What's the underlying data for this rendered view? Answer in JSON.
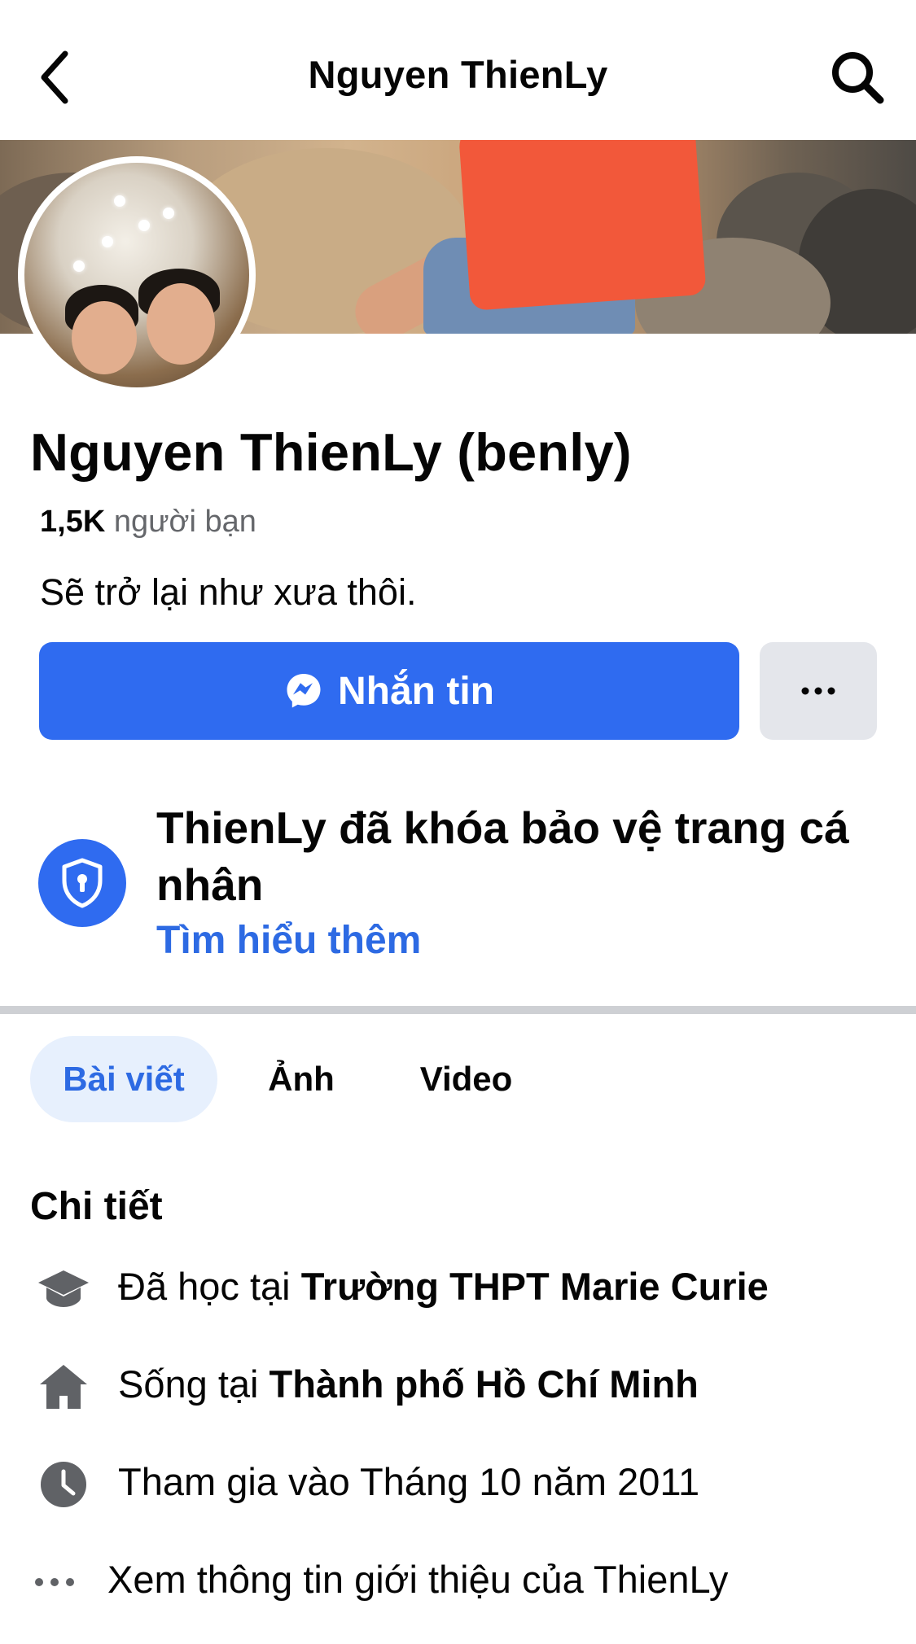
{
  "header": {
    "title": "Nguyen ThienLy",
    "back_icon": "chevron-left-icon",
    "search_icon": "search-icon"
  },
  "profile": {
    "name": "Nguyen ThienLy (benly)",
    "friends_count": "1,5K",
    "friends_label": "người bạn",
    "bio": "Sẽ trở lại như xưa thôi."
  },
  "actions": {
    "message_label": "Nhắn tin",
    "message_icon": "messenger-icon",
    "more_icon": "more-dots-icon"
  },
  "lock_notice": {
    "title": "ThienLy đã khóa bảo vệ trang cá nhân",
    "link": "Tìm hiểu thêm",
    "icon": "shield-lock-icon"
  },
  "tabs": [
    {
      "label": "Bài viết",
      "active": true
    },
    {
      "label": "Ảnh",
      "active": false
    },
    {
      "label": "Video",
      "active": false
    }
  ],
  "details": {
    "title": "Chi tiết",
    "items": [
      {
        "icon": "graduation-cap-icon",
        "prefix": "Đã học tại ",
        "value": "Trường THPT Marie Curie"
      },
      {
        "icon": "home-icon",
        "prefix": "Sống tại ",
        "value": "Thành phố Hồ Chí Minh"
      },
      {
        "icon": "clock-icon",
        "prefix": "Tham gia vào Tháng 10 năm 2011",
        "value": ""
      },
      {
        "icon": "more-dots-icon",
        "prefix": "Xem thông tin giới thiệu của ThienLy",
        "value": ""
      }
    ]
  },
  "colors": {
    "accent": "#2f6bf0",
    "link": "#2d6ae3",
    "secondary_text": "#65676b",
    "button_gray": "#e4e6eb",
    "tab_active_bg": "#e7f0fd"
  }
}
